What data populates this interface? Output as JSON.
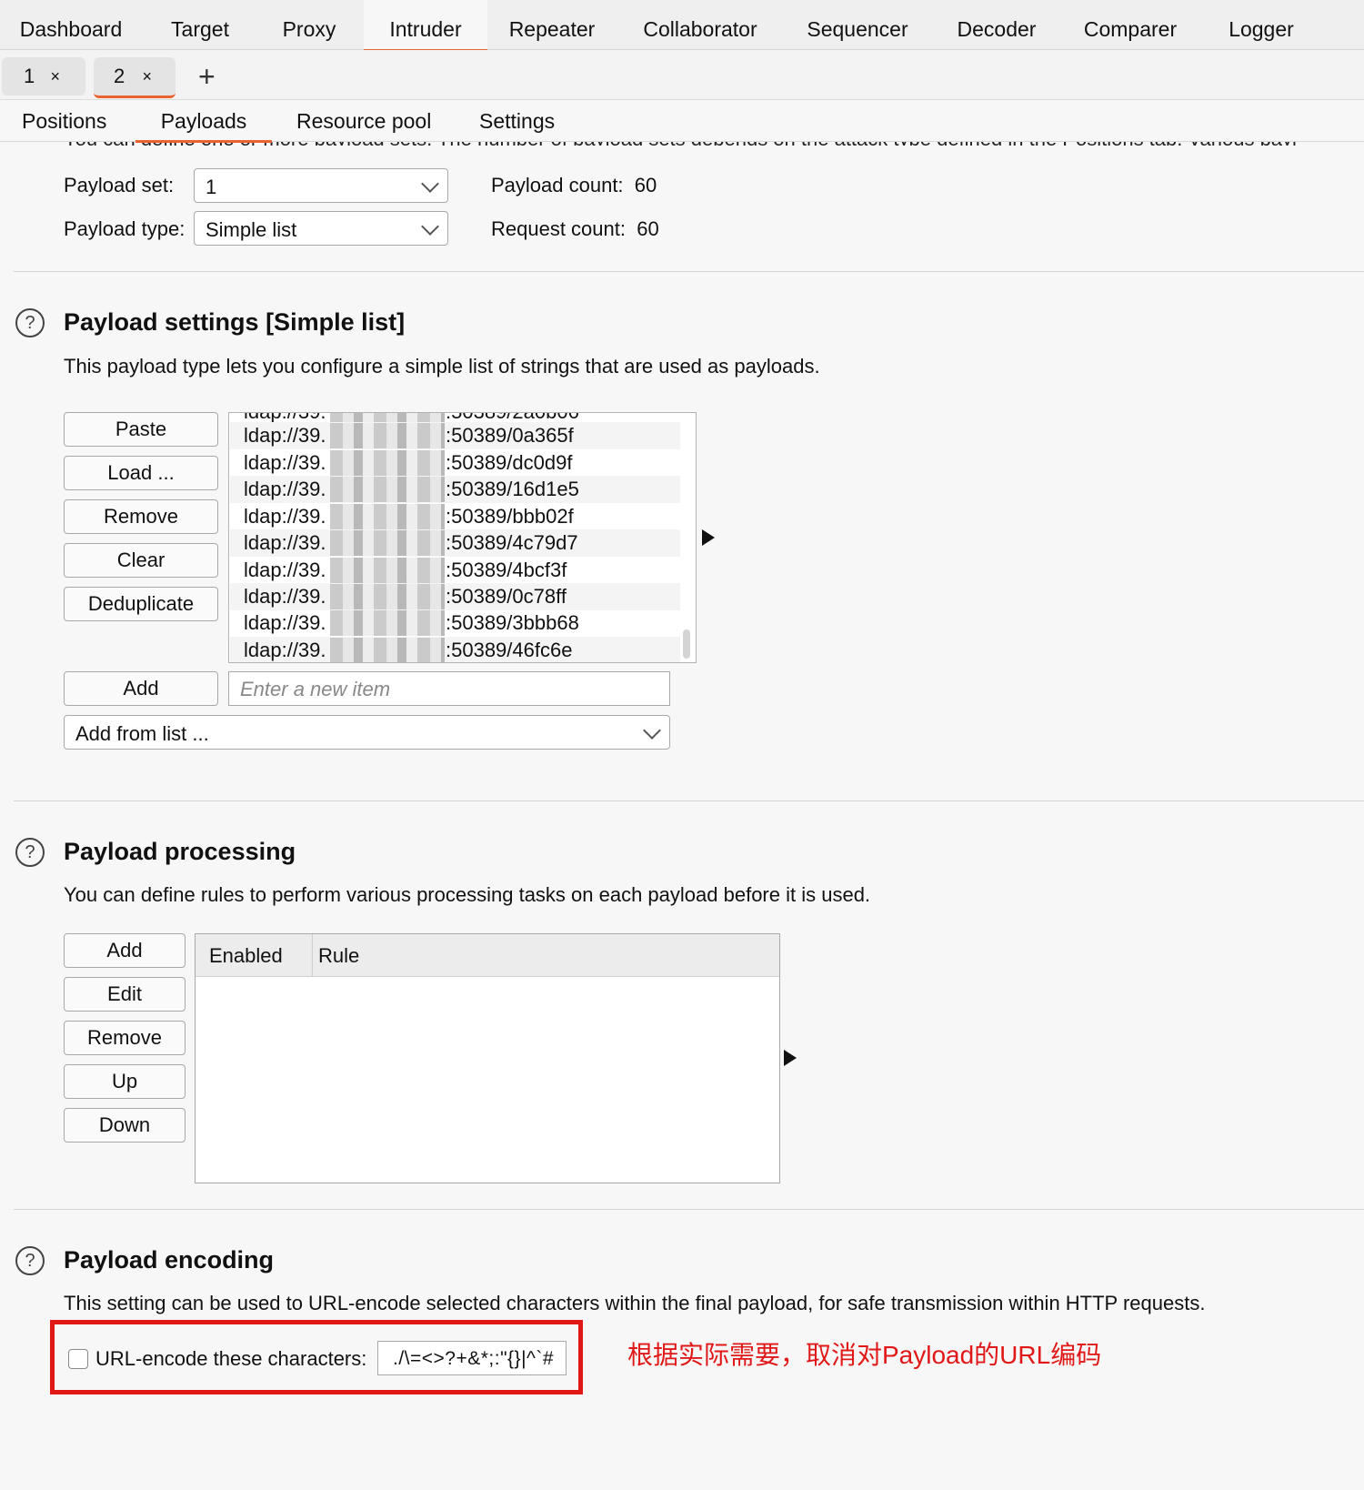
{
  "top_tabs": [
    "Dashboard",
    "Target",
    "Proxy",
    "Intruder",
    "Repeater",
    "Collaborator",
    "Sequencer",
    "Decoder",
    "Comparer",
    "Logger"
  ],
  "attack_tabs": [
    {
      "label": "1",
      "close": "×"
    },
    {
      "label": "2",
      "close": "×"
    }
  ],
  "new_tab": "+",
  "sub_tabs": [
    "Positions",
    "Payloads",
    "Resource pool",
    "Settings"
  ],
  "clipped_description": "You can define one or more payload sets. The number of payload sets depends on the attack type defined in the Positions tab. Various payl",
  "payload_set": {
    "label": "Payload set:",
    "value": "1"
  },
  "payload_type": {
    "label": "Payload type:",
    "value": "Simple list"
  },
  "payload_count": {
    "label": "Payload count:",
    "value": "60"
  },
  "request_count": {
    "label": "Request count:",
    "value": "60"
  },
  "settings_section": {
    "help": "?",
    "title": "Payload settings [Simple list]",
    "description": "This payload type lets you configure a simple list of strings that are used as payloads.",
    "buttons": [
      "Paste",
      "Load ...",
      "Remove",
      "Clear",
      "Deduplicate"
    ],
    "list_items": [
      {
        "prefix": "ldap://39.",
        "suffix": ":50389/0a365f"
      },
      {
        "prefix": "ldap://39.",
        "suffix": ":50389/dc0d9f"
      },
      {
        "prefix": "ldap://39.",
        "suffix": ":50389/16d1e5"
      },
      {
        "prefix": "ldap://39.",
        "suffix": ":50389/bbb02f"
      },
      {
        "prefix": "ldap://39.",
        "suffix": ":50389/4c79d7"
      },
      {
        "prefix": "ldap://39.",
        "suffix": ":50389/4bcf3f"
      },
      {
        "prefix": "ldap://39.",
        "suffix": ":50389/0c78ff"
      },
      {
        "prefix": "ldap://39.",
        "suffix": ":50389/3bbb68"
      },
      {
        "prefix": "ldap://39.",
        "suffix": ":50389/46fc6e"
      }
    ],
    "add_button": "Add",
    "add_placeholder": "Enter a new item",
    "add_from_list": "Add from list ..."
  },
  "processing_section": {
    "help": "?",
    "title": "Payload processing",
    "description": "You can define rules to perform various processing tasks on each payload before it is used.",
    "buttons": [
      "Add",
      "Edit",
      "Remove",
      "Up",
      "Down"
    ],
    "columns": [
      "Enabled",
      "Rule"
    ]
  },
  "encoding_section": {
    "help": "?",
    "title": "Payload encoding",
    "description": "This setting can be used to URL-encode selected characters within the final payload, for safe transmission within HTTP requests.",
    "checkbox_label": "URL-encode these characters:",
    "checkbox_checked": false,
    "characters": "./\\=<>?+&*;:\"{}|^`#"
  },
  "annotation": "根据实际需要，取消对Payload的URL编码",
  "colors": {
    "accent": "#e9622f",
    "highlight": "#e01818"
  }
}
